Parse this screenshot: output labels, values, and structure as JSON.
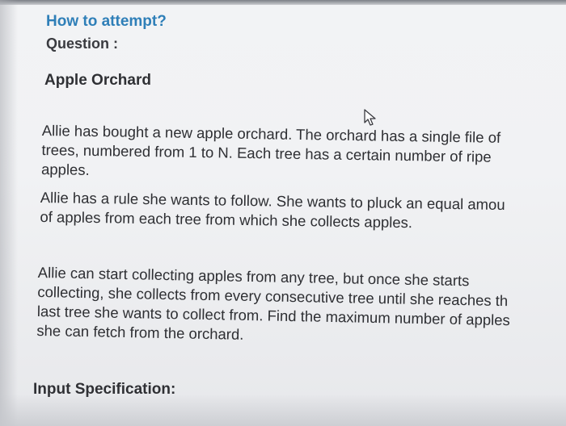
{
  "header": {
    "how_to_attempt": "How to attempt?",
    "question_label": "Question :"
  },
  "question": {
    "title": "Apple Orchard",
    "paragraph1": [
      "Allie has bought a new apple orchard. The orchard has a single file of",
      "trees, numbered from 1 to N. Each tree has a certain number of ripe",
      "apples."
    ],
    "paragraph2": [
      "Allie has a rule she wants to follow. She wants to pluck an equal amou",
      "of apples from each tree from which she collects apples."
    ],
    "paragraph3": [
      "Allie can start collecting apples from any tree, but once she starts",
      "collecting, she collects from every consecutive tree until she reaches th",
      "last tree she wants to collect from. Find the maximum number of apples",
      "she can fetch from the orchard."
    ],
    "input_specification_heading": "Input Specification:"
  },
  "icons": {
    "cursor": "mouse-pointer-icon"
  }
}
